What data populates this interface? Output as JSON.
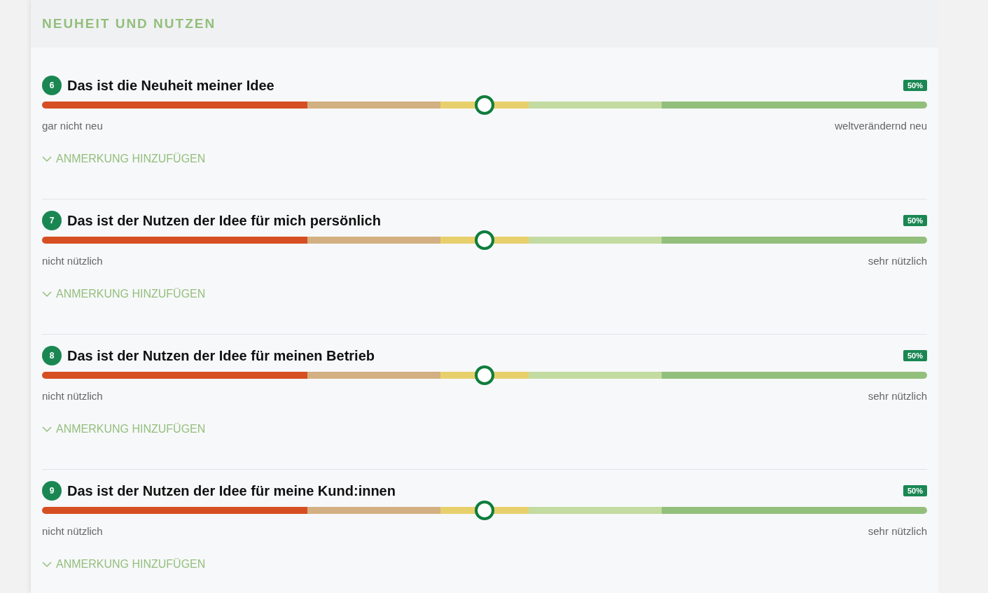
{
  "section": {
    "title": "NEUHEIT UND NUTZEN"
  },
  "questions": [
    {
      "number": "6",
      "title": "Das ist die Neuheit meiner Idee",
      "value": "50%",
      "level": 0.5,
      "min_label": "gar nicht neu",
      "max_label": "weltverändernd neu",
      "note_link": "ANMERKUNG HINZUFÜGEN",
      "expanded": false
    },
    {
      "number": "7",
      "title": "Das ist der Nutzen der Idee für mich persönlich",
      "value": "50%",
      "level": 0.5,
      "min_label": "nicht nützlich",
      "max_label": "sehr nützlich",
      "note_link": "ANMERKUNG HINZUFÜGEN",
      "expanded": false
    },
    {
      "number": "8",
      "title": "Das ist der Nutzen der Idee für meinen Betrieb",
      "value": "50%",
      "level": 0.5,
      "min_label": "nicht nützlich",
      "max_label": "sehr nützlich",
      "note_link": "ANMERKUNG HINZUFÜGEN",
      "expanded": false
    },
    {
      "number": "9",
      "title": "Das ist der Nutzen der Idee für meine Kund:innen",
      "value": "50%",
      "level": 0.5,
      "min_label": "nicht nützlich",
      "max_label": "sehr nützlich",
      "note_link": "ANMERKUNG HINZUFÜGEN",
      "expanded": false
    }
  ]
}
